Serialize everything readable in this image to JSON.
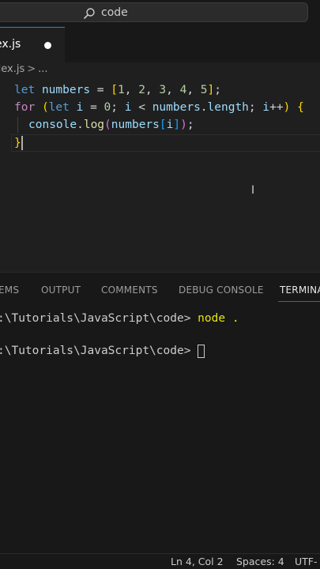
{
  "titlebar": {
    "search_text": "code",
    "search_icon": "search-icon"
  },
  "tabs": [
    {
      "label": "ex.js",
      "dirty": true
    }
  ],
  "breadcrumb": {
    "file": "dex.js",
    "separator": ">",
    "more": "..."
  },
  "editor": {
    "lines": [
      "let numbers = [1, 2, 3, 4, 5];",
      "for (let i = 0; i < numbers.length; i++) {",
      "  console.log(numbers[i]);",
      "}"
    ],
    "tokens": {
      "let1": "let",
      "numbers1": "numbers",
      "eq1": " = ",
      "lbrack": "[",
      "n1": "1",
      "n2": "2",
      "n3": "3",
      "n4": "4",
      "n5": "5",
      "comma": ", ",
      "rbrack": "]",
      "semi": ";",
      "for": "for",
      "lp": "(",
      "let2": "let",
      "i1": "i",
      "eq2": " = ",
      "zero": "0",
      "semi2": "; ",
      "i2": "i",
      "lt": " < ",
      "numbers2": "numbers",
      "dot": ".",
      "length": "length",
      "semi3": "; ",
      "i3": "i",
      "inc": "++",
      "rp": ")",
      "lb": "{",
      "console": "console",
      "log": "log",
      "lp2": "(",
      "numbers3": "numbers",
      "lbr2": "[",
      "i4": "i",
      "rbr2": "]",
      "rp2": ")",
      "semi4": ";",
      "rb": "}"
    }
  },
  "panel": {
    "tabs": [
      "EMS",
      "OUTPUT",
      "COMMENTS",
      "DEBUG CONSOLE",
      "TERMINA"
    ],
    "active_tab": "TERMINA"
  },
  "terminal": {
    "prompt1": ":\\Tutorials\\JavaScript\\code> ",
    "command1": "node .",
    "prompt2": ":\\Tutorials\\JavaScript\\code> "
  },
  "status": {
    "position": "Ln 4, Col 2",
    "spaces": "Spaces: 4",
    "encoding": "UTF-"
  },
  "colors": {
    "accent": "#0078d4",
    "keyword": "#569cd6",
    "control": "#c586c0",
    "variable": "#9cdcfe",
    "function": "#dcdcaa",
    "number": "#b5cea8",
    "bracket_yellow": "#ffd700",
    "bracket_pink": "#da70d6",
    "bracket_blue": "#179fff"
  }
}
